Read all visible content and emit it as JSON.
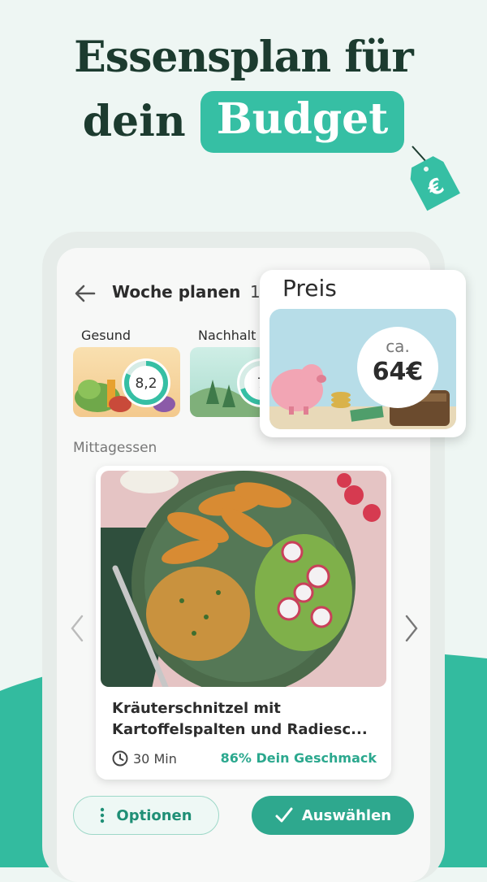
{
  "headline": {
    "line1": "Essensplan für",
    "line2_prefix": "dein",
    "line2_highlight": "Budget",
    "tag_symbol": "€"
  },
  "colors": {
    "accent": "#36bfa4",
    "dark_text": "#1c3b2f",
    "button": "#2ea88e"
  },
  "topbar": {
    "title": "Woche planen",
    "count": "1"
  },
  "scores": [
    {
      "label": "Gesund",
      "value": "8,2",
      "progress": 0.82
    },
    {
      "label": "Nachhalt",
      "value": "7",
      "progress": 0.7
    }
  ],
  "section": {
    "label": "Mittagessen"
  },
  "meal": {
    "title": "Kräuterschnitzel mit Kartoffelspalten und Radiesc...",
    "time": "30 Min",
    "match": "86% Dein Geschmack"
  },
  "buttons": {
    "options": "Optionen",
    "select": "Auswählen"
  },
  "price_card": {
    "title": "Preis",
    "ca": "ca.",
    "value": "64€"
  },
  "icons": [
    "back-arrow-icon",
    "clock-icon",
    "more-vertical-icon",
    "check-icon",
    "chevron-left-icon",
    "chevron-right-icon",
    "euro-tag-icon"
  ]
}
